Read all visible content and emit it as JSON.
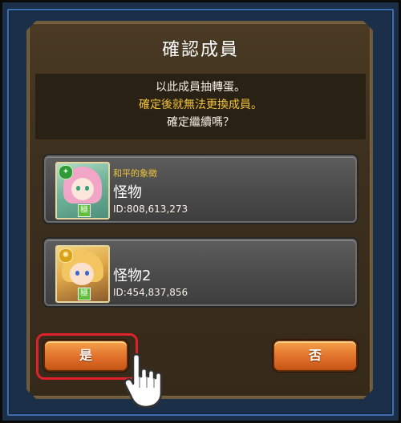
{
  "dialog": {
    "title": "確認成員",
    "message_line1": "以此成員抽轉蛋。",
    "message_line2": "確定後就無法更換成員。",
    "message_line3": "確定繼續嗎？"
  },
  "members": [
    {
      "label": "和平的象徵",
      "name": "怪物",
      "id_text": "ID:808,613,273",
      "element_icon": "wood-element-icon",
      "rank_badge": "極"
    },
    {
      "label": "",
      "name": "怪物2",
      "id_text": "ID:454,837,856",
      "element_icon": "light-element-icon",
      "rank_badge": "極"
    }
  ],
  "buttons": {
    "yes_label": "是",
    "no_label": "否"
  },
  "colors": {
    "accent_text": "#f0c43a",
    "button_orange": "#e0702a",
    "focus_ring": "#e0202a",
    "frame_blue": "#3f6fb0"
  }
}
